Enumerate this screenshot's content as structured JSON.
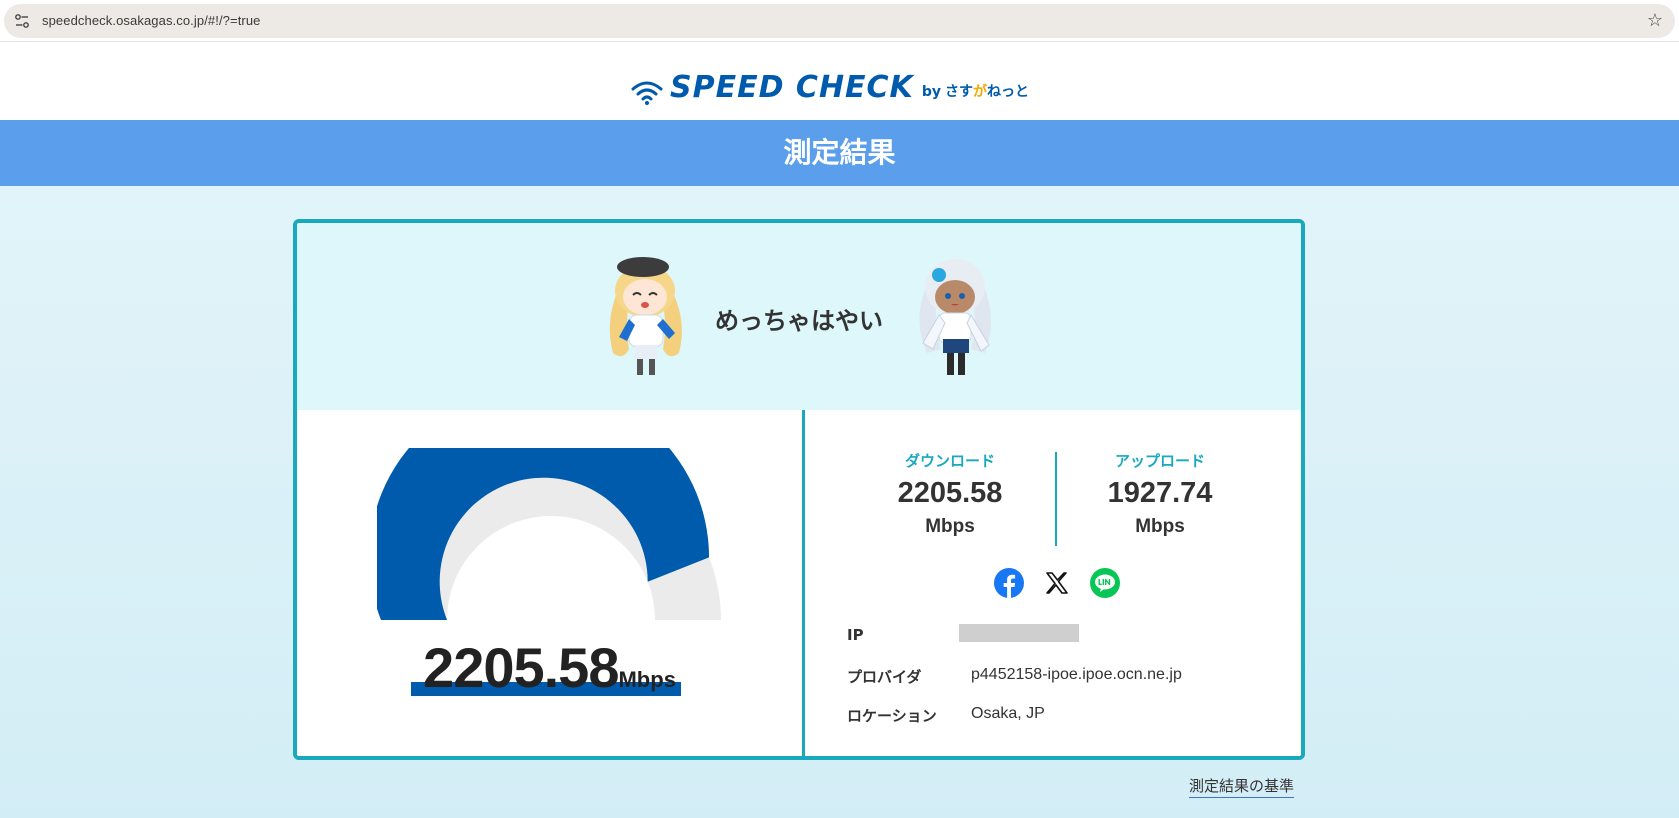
{
  "browser": {
    "url": "speedcheck.osakagas.co.jp/#!/?=true"
  },
  "header": {
    "logo_text": "SPEED CHECK",
    "logo_by": "by",
    "logo_brand_a": "さす",
    "logo_brand_b": "が",
    "logo_brand_c": "ねっと"
  },
  "title": "測定結果",
  "result": {
    "verdict": "めっちゃはやい",
    "gauge_fraction": 0.88,
    "speed_value": "2205.58",
    "speed_unit": "Mbps",
    "download": {
      "label": "ダウンロード",
      "value": "2205.58",
      "unit": "Mbps"
    },
    "upload": {
      "label": "アップロード",
      "value": "1927.74",
      "unit": "Mbps"
    },
    "share_icons": [
      "facebook-icon",
      "x-icon",
      "line-icon"
    ],
    "info": {
      "ip_label": "IP",
      "provider_label": "プロバイダ",
      "provider_value": "p4452158-ipoe.ipoe.ocn.ne.jp",
      "location_label": "ロケーション",
      "location_value": "Osaka, JP"
    }
  },
  "footer": {
    "criteria_link": "測定結果の基準"
  },
  "colors": {
    "brand_blue": "#005bac",
    "title_bar": "#5b9fec",
    "accent_teal": "#18a9bf",
    "gauge_track": "#ebebeb"
  }
}
